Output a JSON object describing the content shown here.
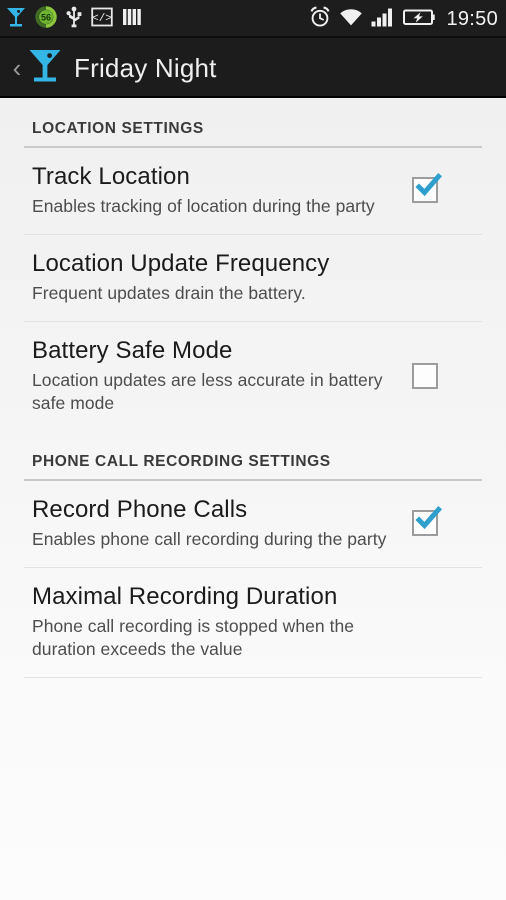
{
  "status_bar": {
    "time": "19:50",
    "left_icons": [
      {
        "name": "cocktail-glass-icon",
        "label": "cocktail"
      },
      {
        "name": "battery-percent-circle-icon",
        "label": "56"
      },
      {
        "name": "usb-icon",
        "label": "usb"
      },
      {
        "name": "developer-code-icon",
        "label": "</>"
      },
      {
        "name": "vertical-bars-icon",
        "label": "bars"
      }
    ],
    "right_icons": [
      {
        "name": "alarm-clock-icon",
        "label": "alarm"
      },
      {
        "name": "wifi-icon",
        "label": "wifi"
      },
      {
        "name": "cellular-signal-icon",
        "label": "signal"
      },
      {
        "name": "battery-charging-icon",
        "label": "battery charging"
      }
    ],
    "battery_percent": "56"
  },
  "action_bar": {
    "back_label": "‹",
    "title": "Friday Night",
    "icon": "cocktail-glass-icon"
  },
  "colors": {
    "accent": "#33b5e5",
    "status_bar_bg": "#1d1d1d",
    "action_bar_bg": "#1c1c1c",
    "title_text": "#1b1b1b",
    "summary_text": "#4d4d4d",
    "divider": "#e2e2e2",
    "section_rule": "#c9c9c9",
    "battery_circle": "#7dc242"
  },
  "sections": [
    {
      "header": "LOCATION SETTINGS",
      "rows": [
        {
          "name": "track-location",
          "title": "Track Location",
          "summary": "Enables tracking of location during the party",
          "widget": "checkbox",
          "checked": true
        },
        {
          "name": "location-update-frequency",
          "title": "Location Update Frequency",
          "summary": "Frequent updates drain the battery.",
          "widget": "none",
          "checked": false
        },
        {
          "name": "battery-safe-mode",
          "title": "Battery Safe Mode",
          "summary": "Location updates are less accurate in battery safe mode",
          "widget": "checkbox",
          "checked": false
        }
      ]
    },
    {
      "header": "PHONE CALL RECORDING SETTINGS",
      "rows": [
        {
          "name": "record-phone-calls",
          "title": "Record Phone Calls",
          "summary": "Enables phone call recording during the party",
          "widget": "checkbox",
          "checked": true
        },
        {
          "name": "maximal-recording-duration",
          "title": "Maximal Recording Duration",
          "summary": "Phone call recording is stopped when the duration exceeds the value",
          "widget": "none",
          "checked": false
        }
      ]
    }
  ]
}
